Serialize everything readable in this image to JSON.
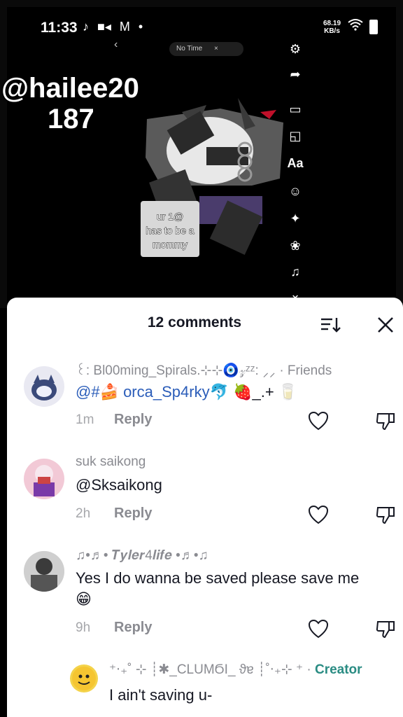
{
  "status_bar": {
    "time": "11:33",
    "left_icons": [
      "tiktok-icon",
      "video-icon",
      "gmail-icon",
      "dot-icon"
    ],
    "net_speed_value": "68.19",
    "net_speed_unit": "KB/s"
  },
  "video": {
    "creator_handle_line1": "@hailee20",
    "creator_handle_line2": "187",
    "pill_label": "No Time",
    "sticker_text_line1": "ur 1@",
    "sticker_text_line2": "has to be a",
    "sticker_text_line3": "mommy",
    "side_tools": [
      "settings-icon",
      "share-icon",
      "crop-icon",
      "sticker-icon",
      "text-icon",
      "emoji-icon",
      "effects-icon",
      "filters-icon",
      "voice-icon",
      "chevron-down-icon"
    ],
    "text_tool_label": "Aa"
  },
  "comments_sheet": {
    "title": "12 comments",
    "comments": [
      {
        "username": "꒰: Bl00ming_Spirals.⊹⊹🧿𝓏ᶻᶻ: ⸝⸝ · Friends",
        "text_mention": "@#🍰 orca_Sp4rky🐬",
        "text_rest": "🍓_.+ 🥛",
        "time": "1m",
        "reply_label": "Reply"
      },
      {
        "username": "suk saikong",
        "text": "@Sksaikong",
        "time": "2h",
        "reply_label": "Reply"
      },
      {
        "username": "♫•♬• 𝑻𝒚𝒍𝒆𝒓4𝒍𝒊𝒇𝒆 •♬•♫",
        "text_line1": "Yes I do wanna be saved please save me",
        "text_line2": "😁",
        "time": "9h",
        "reply_label": "Reply"
      },
      {
        "username": "⁺‧₊˚ ⊹ ┊✱_CLUMϬI_ ϑɐ ┊˚‧₊⊹ ⁺ ·",
        "creator_label": "Creator",
        "text": "I ain't saving u-"
      }
    ]
  },
  "colors": {
    "mention_blue": "#2b5db9",
    "creator_teal": "#2a8c83",
    "text_primary": "#161823",
    "text_secondary": "#8a8b91"
  }
}
